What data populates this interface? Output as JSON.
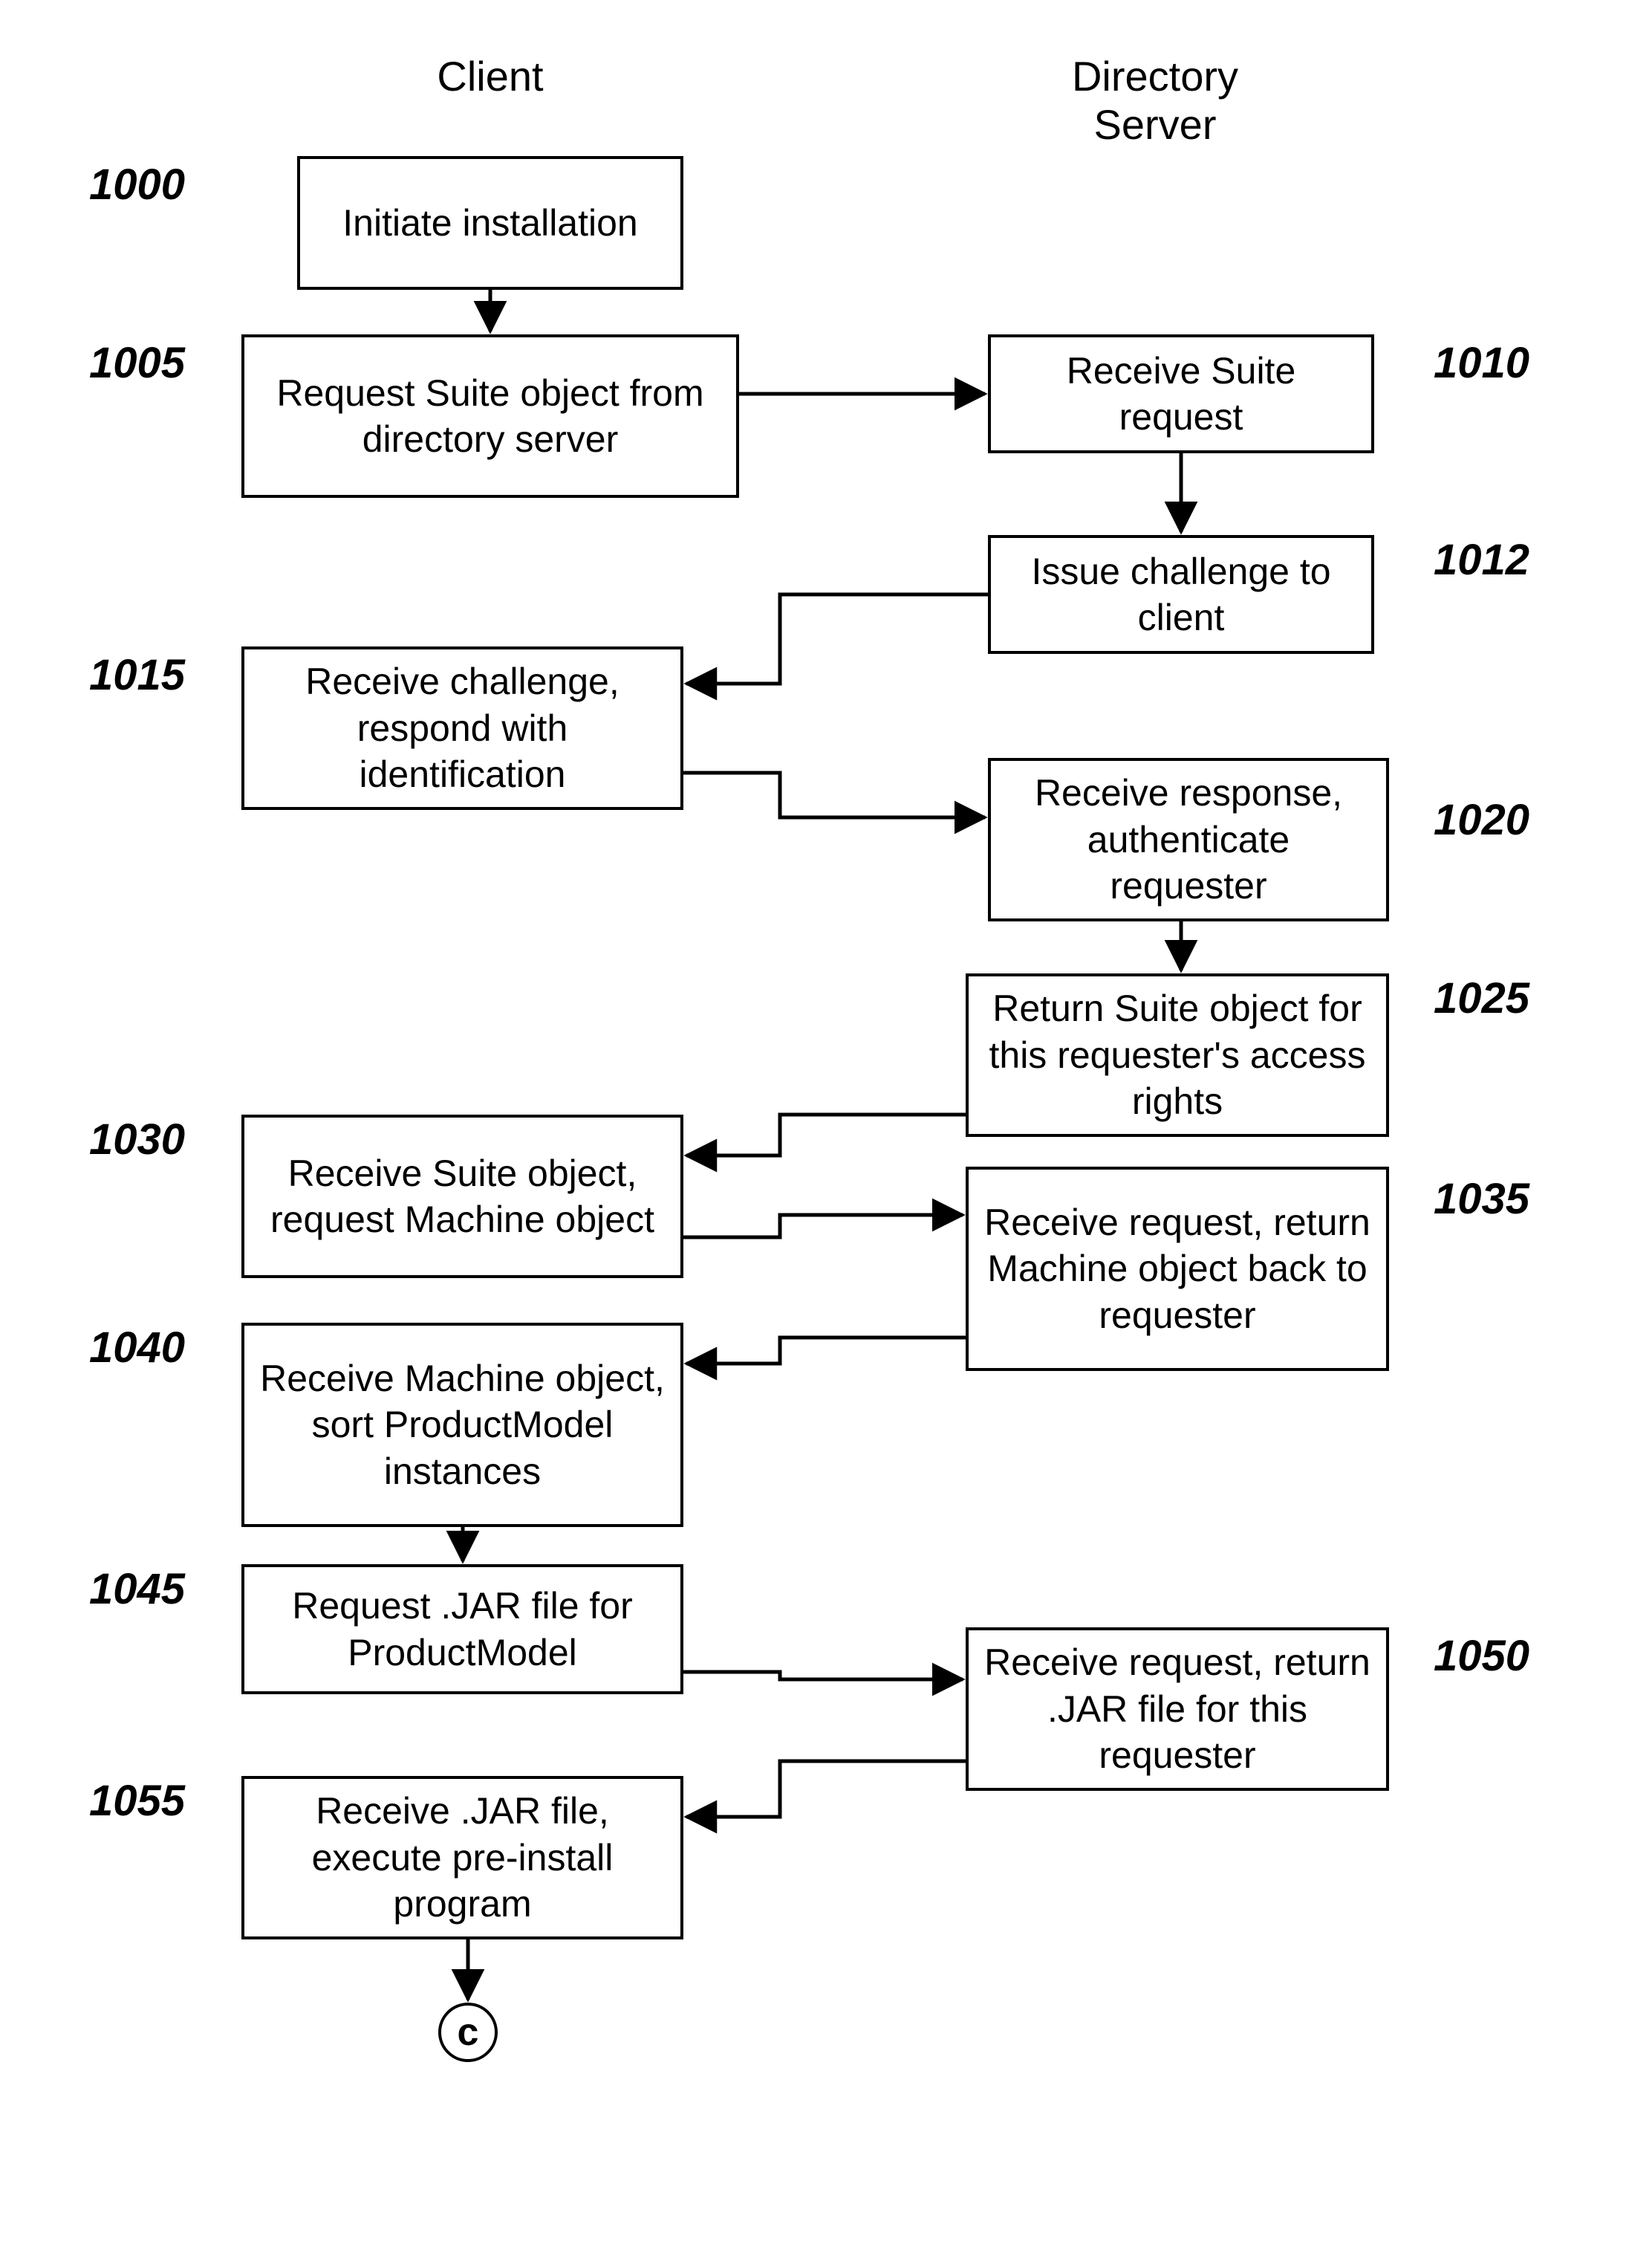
{
  "headers": {
    "client": "Client",
    "server": "Directory\nServer"
  },
  "labels": {
    "n1000": "1000",
    "n1005": "1005",
    "n1010": "1010",
    "n1012": "1012",
    "n1015": "1015",
    "n1020": "1020",
    "n1025": "1025",
    "n1030": "1030",
    "n1035": "1035",
    "n1040": "1040",
    "n1045": "1045",
    "n1050": "1050",
    "n1055": "1055"
  },
  "boxes": {
    "b1000": "Initiate installation",
    "b1005": "Request Suite object from directory server",
    "b1010": "Receive Suite request",
    "b1012": "Issue challenge to client",
    "b1015": "Receive challenge, respond with identification",
    "b1020": "Receive response, authenticate requester",
    "b1025": "Return Suite object for this requester's access rights",
    "b1030": "Receive Suite object, request Machine object",
    "b1035": "Receive request, return Machine object back to requester",
    "b1040": "Receive Machine object, sort ProductModel instances",
    "b1045": "Request .JAR file for ProductModel",
    "b1050": "Receive request, return .JAR file for this requester",
    "b1055": "Receive .JAR file, execute pre-install program"
  },
  "connector": {
    "c": "c"
  }
}
